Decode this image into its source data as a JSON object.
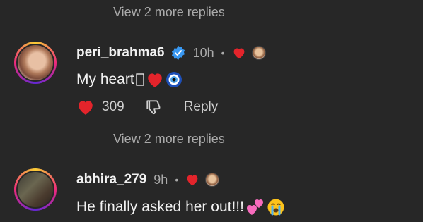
{
  "replies_link_1": "View 2 more replies",
  "replies_link_2": "View 2 more replies",
  "comments": [
    {
      "username": "peri_brahma6",
      "verified": true,
      "time": "10h",
      "separator": "•",
      "text": "My heart",
      "emojis": [
        "box-glyph",
        "red-heart",
        "nazar-amulet"
      ],
      "like_count": "309",
      "reply_label": "Reply"
    },
    {
      "username": "abhira_279",
      "verified": false,
      "time": "9h",
      "separator": "•",
      "text": "He finally asked her out!!!",
      "emojis": [
        "two-hearts",
        "loudly-crying-face"
      ]
    }
  ],
  "colors": {
    "background": "#272727",
    "heart": "#e3242b",
    "verified_blue": "#3897f0",
    "secondary_text": "#aaaaaa"
  }
}
